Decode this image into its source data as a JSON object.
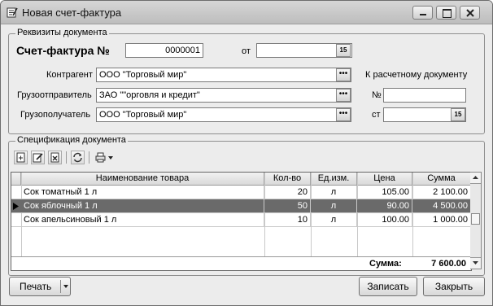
{
  "window": {
    "title": "Новая счет-фактура"
  },
  "requisites": {
    "group_title": "Реквизиты документа",
    "invoice_label": "Счет-фактура №",
    "invoice_number": "0000001",
    "from_label": "от",
    "from_date": "",
    "counterparty_label": "Контрагент",
    "counterparty_value": "ООО \"Торговый мир\"",
    "shipper_label": "Грузоотправитель",
    "shipper_value": "ЗАО \"\"орговля и кредит\"",
    "consignee_label": "Грузополучатель",
    "consignee_value": "ООО \"Торговый мир\"",
    "settlement_doc_label": "К расчетному документу",
    "number_label": "№",
    "number_value": "",
    "st_label": "ст",
    "st_date": ""
  },
  "spec": {
    "group_title": "Спецификация документа",
    "columns": [
      "Наименование товара",
      "Кол-во",
      "Ед.изм.",
      "Цена",
      "Сумма"
    ],
    "rows": [
      {
        "name": "Сок томатный 1 л",
        "qty": "20",
        "unit": "л",
        "price": "105.00",
        "sum": "2 100.00"
      },
      {
        "name": "Сок яблочный 1 л",
        "qty": "50",
        "unit": "л",
        "price": "90.00",
        "sum": "4 500.00"
      },
      {
        "name": "Сок апельсиновый 1 л",
        "qty": "10",
        "unit": "л",
        "price": "100.00",
        "sum": "1 000.00"
      }
    ],
    "total_label": "Сумма:",
    "total_value": "7 600.00"
  },
  "buttons": {
    "print": "Печать",
    "save": "Записать",
    "close": "Закрыть"
  }
}
